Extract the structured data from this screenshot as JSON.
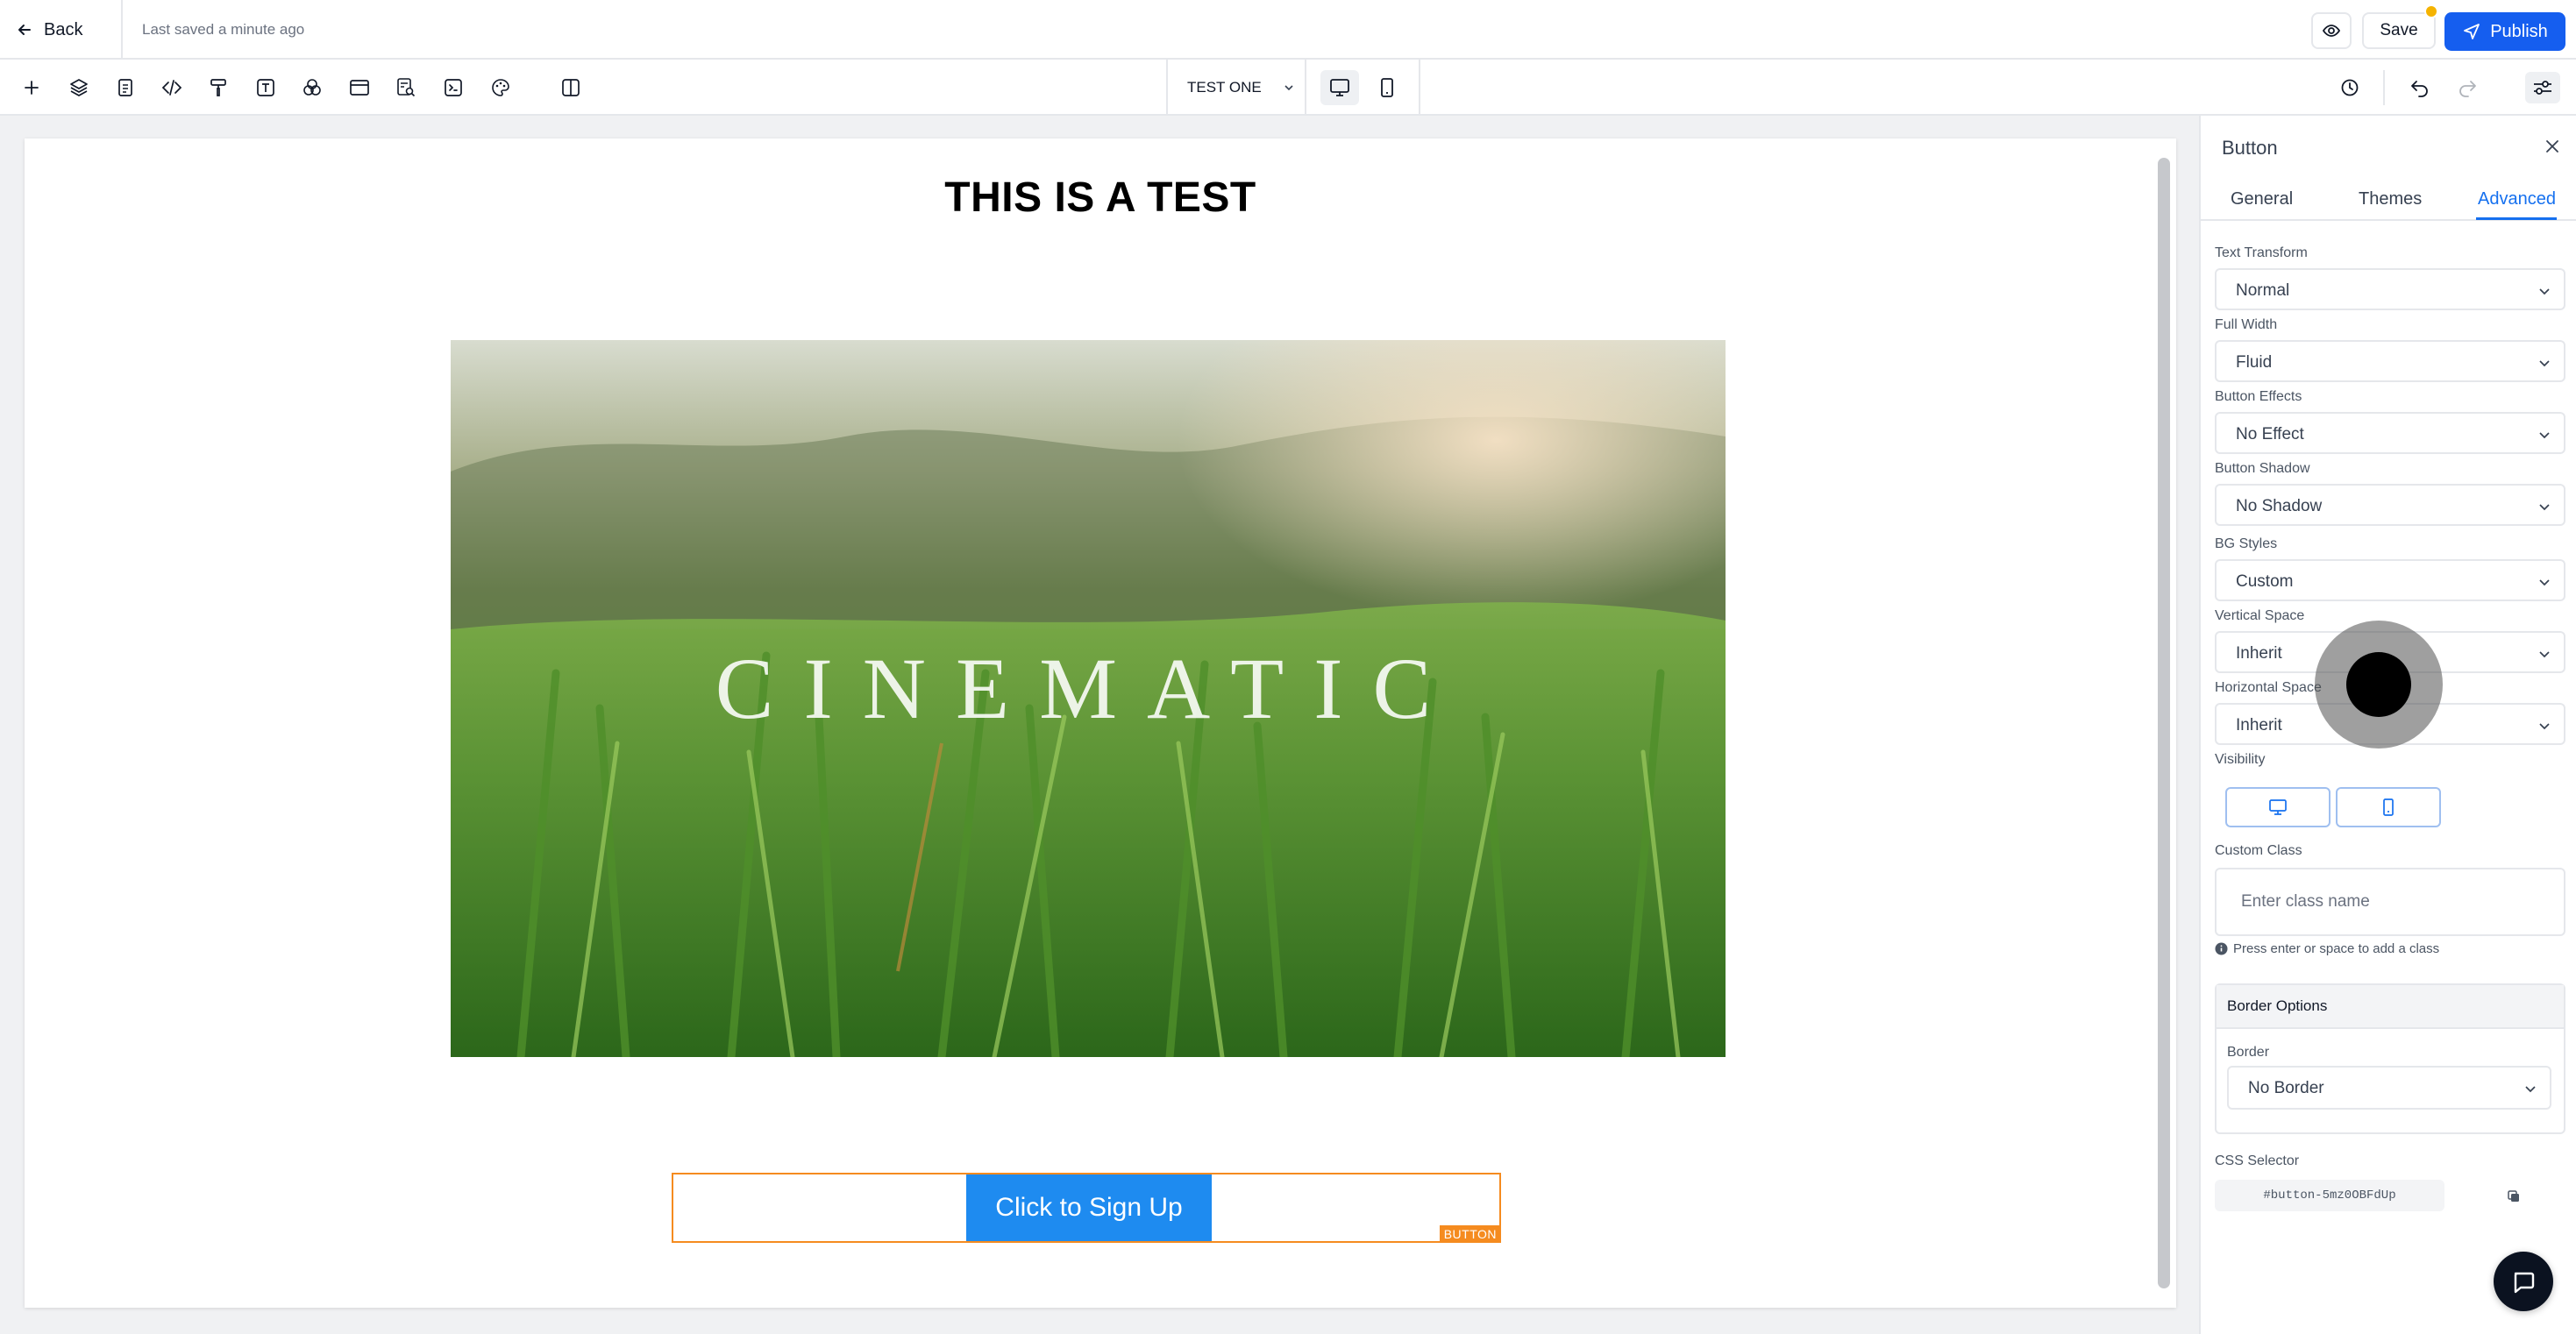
{
  "topbar": {
    "back_label": "Back",
    "saved_status": "Last saved a minute ago",
    "save_label": "Save",
    "publish_label": "Publish"
  },
  "toolbar": {
    "tools": [
      "plus-icon",
      "layers-icon",
      "page-icon",
      "code-icon",
      "paint-roller-icon",
      "text-icon",
      "shapes-icon",
      "section-icon",
      "page-search-icon",
      "terminal-icon",
      "palette-icon",
      "split-view-icon"
    ],
    "page_name": "TEST ONE",
    "devices": [
      "desktop-icon",
      "mobile-icon"
    ],
    "right_tools": [
      "history-icon",
      "undo-icon",
      "redo-icon",
      "settings-sliders-icon"
    ]
  },
  "canvas": {
    "heading": "THIS IS A TEST",
    "hero_text": "CINEMATIC",
    "cta_label": "Click to Sign Up",
    "element_tag": "BUTTON"
  },
  "panel": {
    "title": "Button",
    "tabs": [
      "General",
      "Themes",
      "Advanced"
    ],
    "active_tab": "Advanced",
    "fields": [
      {
        "label": "Text Transform",
        "value": "Normal"
      },
      {
        "label": "Full Width",
        "value": "Fluid"
      },
      {
        "label": "Button Effects",
        "value": "No Effect"
      },
      {
        "label": "Button Shadow",
        "value": "No Shadow"
      },
      {
        "label": "BG Styles",
        "value": "Custom"
      },
      {
        "label": "Vertical Space",
        "value": "Inherit"
      },
      {
        "label": "Horizontal Space",
        "value": "Inherit"
      }
    ],
    "visibility_label": "Visibility",
    "custom_class_label": "Custom Class",
    "custom_class_placeholder": "Enter class name",
    "hint": "Press enter or space to add a class",
    "border_options_title": "Border Options",
    "border_label": "Border",
    "border_value": "No Border",
    "css_selector_label": "CSS Selector",
    "css_selector": "#button-5mz0OBFdUp"
  },
  "colors": {
    "accent": "#155eef",
    "cta": "#1e8bf0",
    "selection": "#f58b1f",
    "notification": "#f5b301"
  }
}
